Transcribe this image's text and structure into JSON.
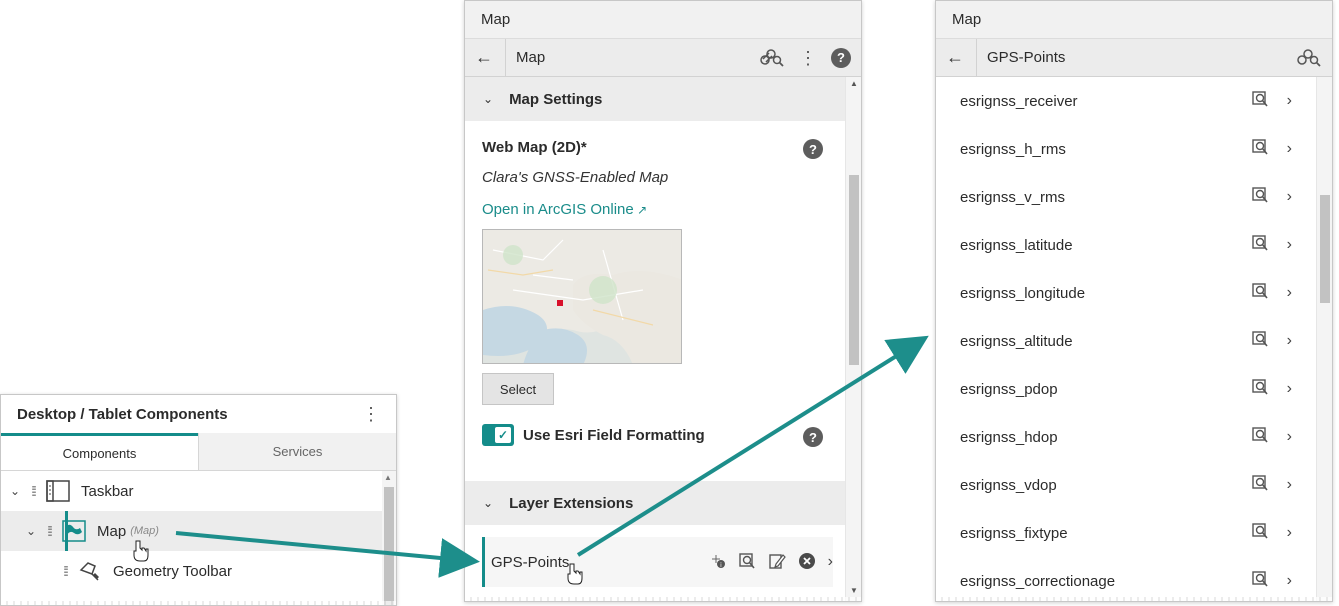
{
  "left_panel": {
    "title": "Desktop / Tablet Components",
    "tabs": [
      {
        "label": "Components",
        "active": true
      },
      {
        "label": "Services",
        "active": false
      }
    ],
    "tree": [
      {
        "label": "Taskbar",
        "sub": ""
      },
      {
        "label": "Map",
        "sub": "(Map)"
      },
      {
        "label": "Geometry Toolbar",
        "sub": ""
      }
    ]
  },
  "middle_panel": {
    "top_title": "Map",
    "nav_title": "Map",
    "sections": {
      "map_settings": "Map Settings",
      "layer_extensions": "Layer Extensions"
    },
    "web_map_label": "Web Map (2D)*",
    "web_map_name": "Clara's GNSS-Enabled Map",
    "open_link": "Open in ArcGIS Online",
    "select_button": "Select",
    "toggle_label": "Use Esri Field Formatting",
    "toggle_checked": true,
    "layer_name": "GPS-Points"
  },
  "right_panel": {
    "top_title": "Map",
    "nav_title": "GPS-Points",
    "fields": [
      "esrignss_receiver",
      "esrignss_h_rms",
      "esrignss_v_rms",
      "esrignss_latitude",
      "esrignss_longitude",
      "esrignss_altitude",
      "esrignss_pdop",
      "esrignss_hdop",
      "esrignss_vdop",
      "esrignss_fixtype",
      "esrignss_correctionage"
    ]
  },
  "colors": {
    "accent": "#148c8a",
    "link": "#1a8c8a",
    "header_bg": "#ececec"
  },
  "icons": {
    "help": "?",
    "back": "←",
    "kebab": "⋮"
  }
}
